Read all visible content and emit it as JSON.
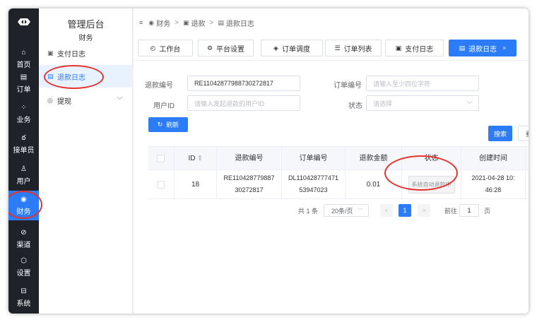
{
  "rail": {
    "items": [
      {
        "label": "首页",
        "icon": "home-icon",
        "glyph": "⌂"
      },
      {
        "label": "订单",
        "icon": "order-icon",
        "glyph": "▤"
      },
      {
        "label": "业务",
        "icon": "grid-icon",
        "glyph": "⁘"
      },
      {
        "label": "接单员",
        "icon": "bike-icon",
        "glyph": "ఠ"
      },
      {
        "label": "用户",
        "icon": "user-icon",
        "glyph": "♙"
      },
      {
        "label": "财务",
        "icon": "finance-icon",
        "glyph": "◉"
      },
      {
        "label": "渠道",
        "icon": "channel-icon",
        "glyph": "⊘"
      },
      {
        "label": "设置",
        "icon": "settings-icon",
        "glyph": "⬡"
      },
      {
        "label": "系统",
        "icon": "system-icon",
        "glyph": "⊟"
      }
    ]
  },
  "sidebar": {
    "title": "管理后台",
    "subtitle": "财务",
    "items": [
      {
        "label": "支付日志",
        "glyph": "▣"
      },
      {
        "label": "退款日志",
        "glyph": "▤"
      },
      {
        "label": "提现",
        "glyph": "◎",
        "chevron": "﹀"
      }
    ]
  },
  "breadcrumb": {
    "menu_glyph": "≡",
    "items": [
      {
        "label": "财务",
        "glyph": "◉"
      },
      {
        "label": "退款",
        "glyph": "▣"
      },
      {
        "label": "退款日志",
        "glyph": "▤"
      }
    ],
    "separator": ">"
  },
  "tabs": [
    {
      "label": "工作台",
      "glyph": "◴"
    },
    {
      "label": "平台设置",
      "glyph": "⚙"
    },
    {
      "label": "订单调度",
      "glyph": "◈"
    },
    {
      "label": "订单列表",
      "glyph": "☰"
    },
    {
      "label": "支付日志",
      "glyph": "▣"
    },
    {
      "label": "退款日志",
      "glyph": "▤",
      "close": "×"
    }
  ],
  "filters": {
    "refund_no": {
      "label": "退款编号",
      "value": "RE11042877988730272817"
    },
    "order_no": {
      "label": "订单编号",
      "placeholder": "请输入至少四位字符"
    },
    "user_id": {
      "label": "用户ID",
      "placeholder": "请输入发起退款的用户ID"
    },
    "status": {
      "label": "状态",
      "placeholder": "请选择",
      "chevron": "﹀"
    }
  },
  "buttons": {
    "refresh": "刷新",
    "refresh_glyph": "↻",
    "search": "搜索",
    "reset": "重置"
  },
  "table": {
    "headers": [
      "ID",
      "退款编号",
      "订单编号",
      "退款金额",
      "状态",
      "创建时间"
    ],
    "rows": [
      {
        "id": "18",
        "refund_no": "RE110428779887 30272817",
        "order_no": "DL110428777471 53947023",
        "amount": "0.01",
        "status": "系统自动退款中",
        "created": "2021-04-28 10: 46:28"
      }
    ]
  },
  "pagination": {
    "total": "共 1 条",
    "page_size": "20条/页",
    "prev": "<",
    "current": "1",
    "next": ">",
    "goto": "前往",
    "goto_value": "1",
    "page_unit": "页"
  },
  "colors": {
    "accent": "#2b7cf6",
    "rail_bg": "#1f2329",
    "annotation": "#e5322d"
  }
}
